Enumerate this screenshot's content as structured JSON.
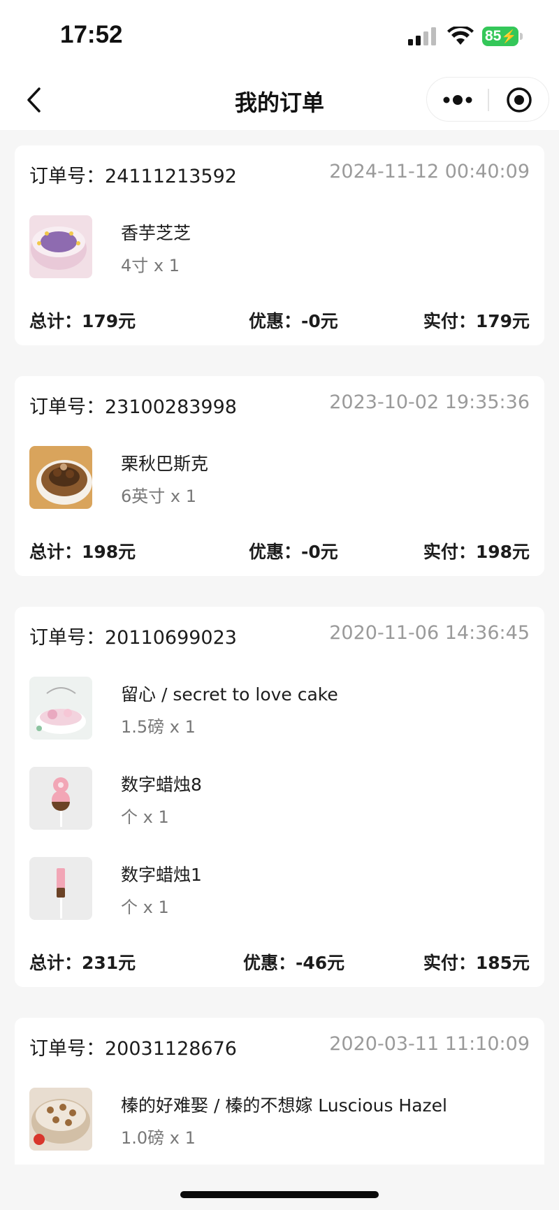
{
  "status_bar": {
    "time": "17:52",
    "battery": "85",
    "battery_color": "#34c759",
    "icons": [
      "signal-icon",
      "wifi-icon",
      "battery-icon"
    ]
  },
  "nav": {
    "title": "我的订单",
    "back_icon": "chevron-left-icon",
    "more_icon": "more-dots-icon",
    "close_icon": "target-close-icon"
  },
  "orders": [
    {
      "order_no_label": "订单号：",
      "order_no": "24111213592",
      "time": "2024-11-12 00:40:09",
      "items": [
        {
          "name": "香芋芝芝",
          "spec": "4寸 x 1",
          "thumb_color": "#c9a7d8"
        }
      ],
      "total": "总计：179元",
      "discount": "优惠：-0元",
      "paid": "实付：179元"
    },
    {
      "order_no_label": "订单号：",
      "order_no": "23100283998",
      "time": "2023-10-02 19:35:36",
      "items": [
        {
          "name": "栗秋巴斯克",
          "spec": "6英寸 x 1",
          "thumb_color": "#b5804a"
        }
      ],
      "total": "总计：198元",
      "discount": "优惠：-0元",
      "paid": "实付：198元"
    },
    {
      "order_no_label": "订单号：",
      "order_no": "20110699023",
      "time": "2020-11-06 14:36:45",
      "items": [
        {
          "name": "留心 / secret to love cake",
          "spec": "1.5磅 x 1",
          "thumb_color": "#eef2f0"
        },
        {
          "name": "数字蜡烛8",
          "spec": "个 x 1",
          "thumb_color": "#ececec"
        },
        {
          "name": "数字蜡烛1",
          "spec": "个 x 1",
          "thumb_color": "#ececec"
        }
      ],
      "total": "总计：231元",
      "discount": "优惠：-46元",
      "paid": "实付：185元"
    },
    {
      "order_no_label": "订单号：",
      "order_no": "20031128676",
      "time": "2020-03-11 11:10:09",
      "items": [
        {
          "name": "榛的好难娶 / 榛的不想嫁 Luscious Hazel",
          "spec": "1.0磅 x 1",
          "thumb_color": "#d8c6b0"
        }
      ],
      "total": "",
      "discount": "",
      "paid": ""
    }
  ]
}
